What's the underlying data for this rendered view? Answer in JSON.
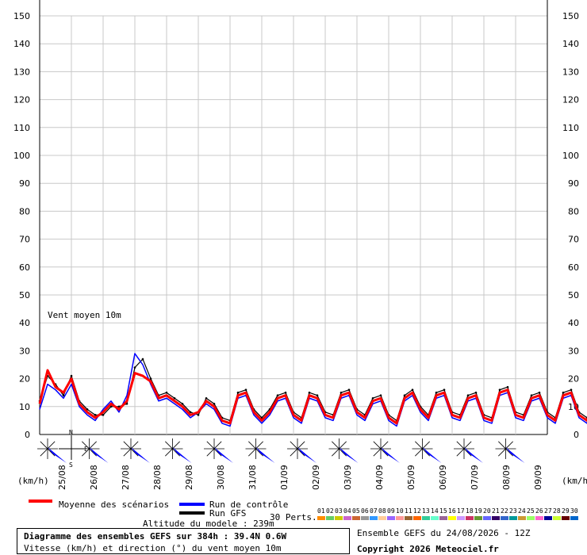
{
  "colors": {
    "mean": "#ff0000",
    "control": "#0000ff",
    "gfs": "#000000",
    "grid": "#c8c8c8",
    "wind_arrow": "#0000ff"
  },
  "legend": {
    "mean_label": "Moyenne des scénarios",
    "control_label": "Run de contrôle",
    "gfs_label": "Run GFS",
    "perts_label": "30 Perts.",
    "altitude": "Altitude du modele : 239m",
    "pert_numbers": [
      "01",
      "02",
      "03",
      "04",
      "05",
      "06",
      "07",
      "08",
      "09",
      "10",
      "11",
      "12",
      "13",
      "14",
      "15",
      "16",
      "17",
      "18",
      "19",
      "20",
      "21",
      "22",
      "23",
      "24",
      "25",
      "26",
      "27",
      "28",
      "29",
      "30"
    ],
    "pert_colors": [
      "#ff8c00",
      "#66cc66",
      "#cccc00",
      "#cc66cc",
      "#cc6633",
      "#999999",
      "#3399ff",
      "#ffcc99",
      "#9966ff",
      "#ff9999",
      "#996633",
      "#ff6600",
      "#33cc99",
      "#66ffcc",
      "#996699",
      "#ffff00",
      "#cc99ff",
      "#cc3366",
      "#669933",
      "#6666ff",
      "#330066",
      "#3366cc",
      "#009999",
      "#cc9933",
      "#99ff66",
      "#ff66cc",
      "#000099",
      "#ccff33",
      "#660000",
      "#0066cc"
    ]
  },
  "footer": {
    "title": "Diagramme des ensembles GEFS sur 384h : 39.4N 0.6W",
    "subtitle": "Vitesse (km/h) et direction (°) du vent moyen 10m",
    "run": "Ensemble GEFS du 24/08/2026 - 12Z",
    "copyright": "Copyright 2026 Meteociel.fr"
  },
  "compass": {
    "n": "N",
    "s": "S",
    "e": "E"
  },
  "chart_data": {
    "type": "line",
    "annotation": "Vent moyen 10m",
    "unit_left": "(km/h)",
    "unit_right": "(km/h)",
    "ylim": [
      0,
      150
    ],
    "yticks": [
      0,
      10,
      20,
      30,
      40,
      50,
      60,
      70,
      80,
      90,
      100,
      110,
      120,
      130,
      140,
      150
    ],
    "xlim": [
      0,
      384
    ],
    "grid": true,
    "date_labels": [
      "25/08",
      "26/08",
      "27/08",
      "28/08",
      "29/08",
      "30/08",
      "31/08",
      "01/09",
      "02/09",
      "03/09",
      "04/09",
      "05/09",
      "06/09",
      "07/09",
      "08/09",
      "09/09"
    ],
    "step_hours": 6,
    "series": [
      {
        "name": "Moyenne des scénarios",
        "values": [
          11,
          23,
          17,
          15,
          20,
          11,
          8,
          6,
          8,
          11,
          9,
          12,
          22,
          21,
          19,
          13,
          14,
          12,
          10,
          7,
          8,
          12,
          10,
          5,
          4,
          14,
          15,
          8,
          5,
          8,
          13,
          14,
          7,
          5,
          14,
          13,
          7,
          6,
          14,
          15,
          8,
          6,
          12,
          13,
          6,
          4,
          13,
          15,
          9,
          6,
          14,
          15,
          7,
          6,
          13,
          14,
          6,
          5,
          15,
          16,
          7,
          6,
          13,
          14,
          7,
          5,
          14,
          15,
          7,
          5,
          13,
          14,
          6,
          5,
          14,
          15,
          7,
          4,
          13,
          14,
          6,
          5,
          12,
          14,
          7,
          5
        ]
      },
      {
        "name": "Run de contrôle",
        "values": [
          9,
          18,
          16,
          13,
          18,
          10,
          7,
          5,
          9,
          12,
          8,
          14,
          29,
          25,
          18,
          12,
          13,
          11,
          9,
          6,
          8,
          11,
          9,
          4,
          3,
          13,
          14,
          7,
          4,
          7,
          12,
          13,
          6,
          4,
          13,
          12,
          6,
          5,
          13,
          14,
          7,
          5,
          11,
          12,
          5,
          3,
          12,
          14,
          8,
          5,
          13,
          14,
          6,
          5,
          12,
          13,
          5,
          4,
          14,
          15,
          6,
          5,
          12,
          13,
          6,
          4,
          13,
          14,
          6,
          4,
          12,
          13,
          5,
          4,
          13,
          14,
          6,
          3,
          12,
          13,
          5,
          4,
          11,
          13,
          6,
          4
        ]
      },
      {
        "name": "Run GFS",
        "values": [
          12,
          21,
          18,
          14,
          21,
          12,
          9,
          7,
          7,
          10,
          10,
          11,
          24,
          27,
          20,
          14,
          15,
          13,
          11,
          8,
          7,
          13,
          11,
          6,
          5,
          15,
          16,
          9,
          6,
          9,
          14,
          15,
          8,
          6,
          15,
          14,
          8,
          7,
          15,
          16,
          9,
          7,
          13,
          14,
          7,
          5,
          14,
          16,
          10,
          7,
          15,
          16,
          8,
          7,
          14,
          15,
          7,
          6,
          16,
          17,
          8,
          7,
          14,
          15,
          8,
          6,
          15,
          16,
          8,
          6,
          14,
          15,
          7,
          6,
          15,
          16,
          8,
          5,
          14,
          15,
          7,
          6,
          13,
          15,
          8,
          6
        ]
      }
    ],
    "wind_direction_deg": [
      100,
      110,
      120,
      120,
      110,
      115,
      120,
      120,
      115,
      110,
      100,
      100
    ]
  }
}
